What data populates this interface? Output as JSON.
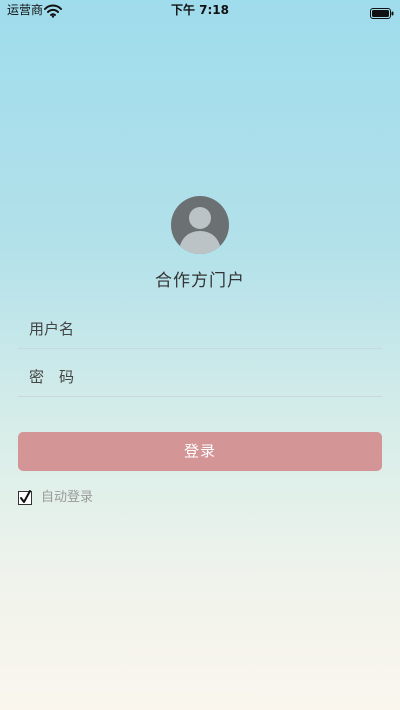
{
  "status_bar": {
    "carrier": "运营商",
    "time": "下午 7:18",
    "icons": [
      "wifi-icon",
      "battery-icon"
    ]
  },
  "login": {
    "title": "合作方门户",
    "avatar_icon": "user-avatar-icon",
    "username_label": "用户名",
    "username_value": "",
    "password_label": "密　码",
    "password_value": "",
    "login_button_label": "登录",
    "auto_login_label": "自动登录",
    "auto_login_checked": true
  },
  "colors": {
    "login_button": "#d49597",
    "avatar_bg": "#6b7072",
    "gradient_top": "#9fdcec",
    "gradient_bottom": "#faf6ee"
  }
}
